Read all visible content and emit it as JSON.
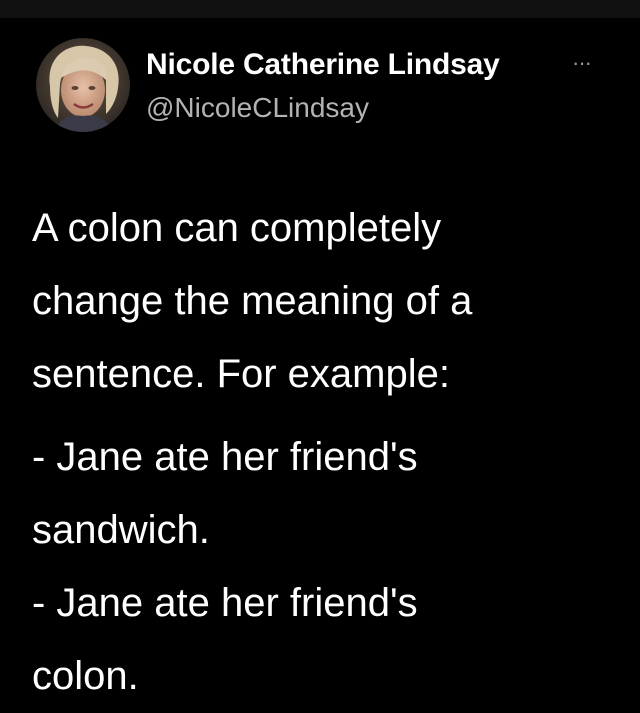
{
  "author": {
    "name": "Nicole Catherine Lindsay",
    "handle": "@NicoleCLindsay",
    "more_label": "···"
  },
  "tweet": {
    "text_intro": "A colon can completely change the meaning of a sentence. For example:",
    "example_lines": [
      "- Jane ate her friend's",
      "sandwich.",
      "- Jane ate her friend's",
      "colon."
    ]
  },
  "colors": {
    "background": "#000000",
    "text": "#ffffff",
    "secondary_text": "#b3b3b3"
  },
  "icons": {
    "avatar": "profile-photo",
    "more": "ellipsis-icon"
  }
}
